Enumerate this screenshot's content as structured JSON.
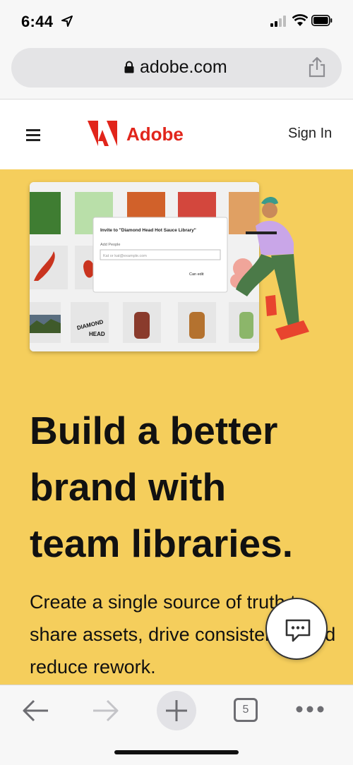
{
  "status_bar": {
    "time": "6:44"
  },
  "browser": {
    "url": "adobe.com",
    "open_tabs": "5"
  },
  "site_header": {
    "brand": "Adobe",
    "sign_in": "Sign In"
  },
  "illustration": {
    "dialog_title": "Invite to \"Diamond Head Hot Sauce Library\"",
    "dialog_label": "Add People",
    "dialog_placeholder": "Kat or kat@example.com",
    "dialog_permission": "Can edit",
    "label_brand_top": "DIAMOND",
    "label_brand_bottom": "HEAD",
    "swatches": [
      "#3f7d32",
      "#b9dfa9",
      "#d1612a",
      "#d3473d",
      "#e0a063"
    ]
  },
  "hero": {
    "headline_line1": "Build a better",
    "headline_line2": "brand with",
    "headline_line3": "team libraries.",
    "body": "Create a single source of truth to share assets, drive consistency, and reduce rework."
  },
  "colors": {
    "hero_bg": "#f5ce5c",
    "adobe_red": "#e1251b"
  },
  "icons": [
    "location-arrow-icon",
    "signal-icon",
    "wifi-icon",
    "battery-icon",
    "lock-icon",
    "share-icon",
    "menu-icon",
    "adobe-logo-icon",
    "chat-icon",
    "back-icon",
    "forward-icon",
    "new-tab-icon",
    "tabs-icon",
    "more-icon"
  ]
}
